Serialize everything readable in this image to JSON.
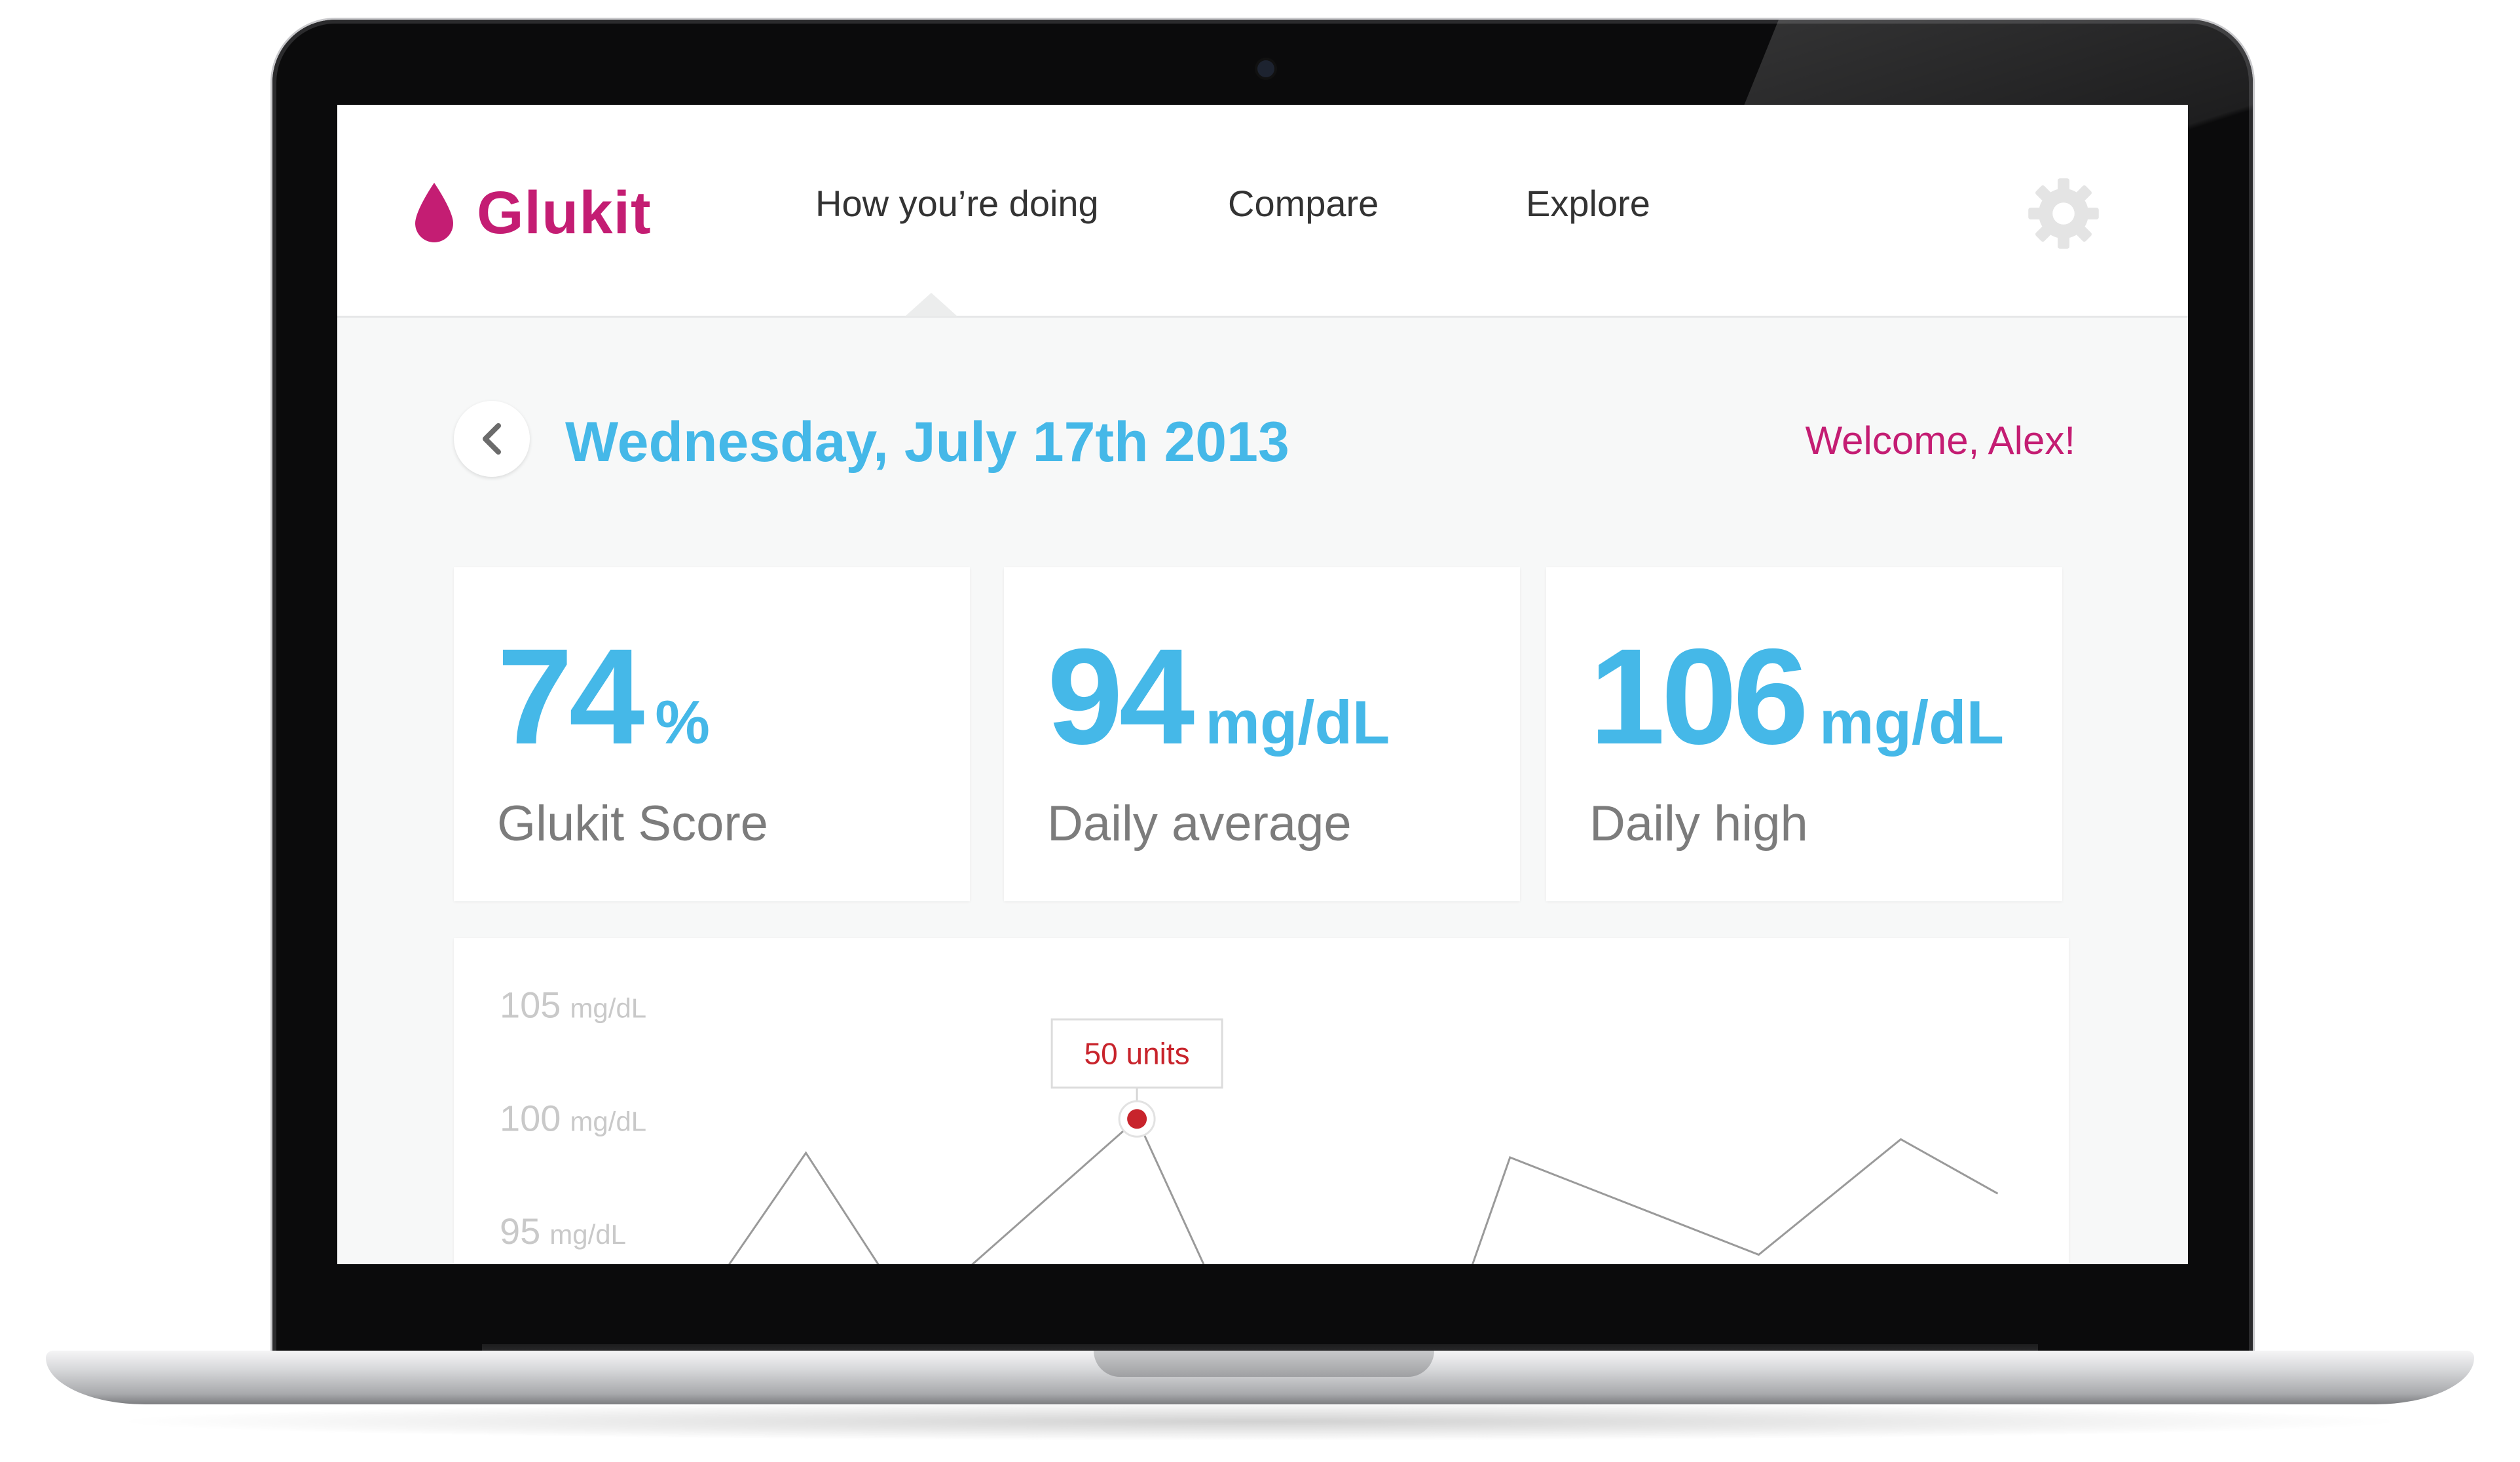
{
  "app": {
    "name": "Glukit",
    "brand_color": "#c41d73",
    "accent_color": "#45b8e8"
  },
  "nav": {
    "items": [
      {
        "label": "How you’re doing",
        "active": true
      },
      {
        "label": "Compare",
        "active": false
      },
      {
        "label": "Explore",
        "active": false
      }
    ],
    "settings_icon": "gear-icon"
  },
  "page": {
    "back_icon": "chevron-left-icon",
    "title": "Wednesday, July 17th 2013",
    "welcome": "Welcome, Alex!"
  },
  "stats": [
    {
      "value": "74",
      "unit": "%",
      "label": "Glukit Score"
    },
    {
      "value": "94",
      "unit": "mg/dL",
      "label": "Daily average"
    },
    {
      "value": "106",
      "unit": "mg/dL",
      "label": "Daily high"
    }
  ],
  "chart_data": {
    "type": "line",
    "y_ticks": [
      {
        "value": 105,
        "unit": "mg/dL"
      },
      {
        "value": 100,
        "unit": "mg/dL"
      },
      {
        "value": 95,
        "unit": "mg/dL"
      }
    ],
    "ylim": [
      93,
      108
    ],
    "xlim": [
      0,
      100
    ],
    "segments": [
      [
        [
          16.5,
          93
        ],
        [
          21.8,
          98.5
        ],
        [
          26.8,
          93
        ]
      ],
      [
        [
          31.2,
          93
        ],
        [
          42.3,
          100
        ],
        [
          46.8,
          93
        ]
      ],
      [
        [
          62.8,
          93
        ],
        [
          65.4,
          98.3
        ],
        [
          80.8,
          94
        ],
        [
          89.6,
          99.1
        ],
        [
          95.6,
          96.7
        ]
      ]
    ],
    "annotation": {
      "x": 42.3,
      "y": 100,
      "label": "50 units",
      "color": "#c8242c"
    },
    "grid": false,
    "line_color": "#9a9a9a"
  }
}
